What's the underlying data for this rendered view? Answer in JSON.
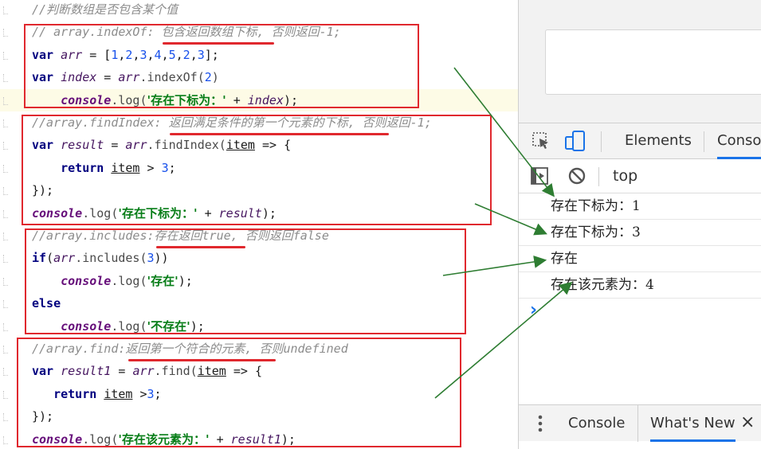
{
  "code_lines": [
    {
      "segments": [
        {
          "c": "cm",
          "t": "//判断数组是否包含某个值"
        }
      ]
    },
    {
      "segments": [
        {
          "c": "cm",
          "t": "// array.indexOf: 包含返回数组下标, 否则返回-1;"
        }
      ]
    },
    {
      "segments": [
        {
          "c": "kw",
          "t": "var "
        },
        {
          "c": "var",
          "t": "arr"
        },
        {
          "c": "",
          "t": " = ["
        },
        {
          "c": "num",
          "t": "1"
        },
        {
          "c": "",
          "t": ","
        },
        {
          "c": "num",
          "t": "2"
        },
        {
          "c": "",
          "t": ","
        },
        {
          "c": "num",
          "t": "3"
        },
        {
          "c": "",
          "t": ","
        },
        {
          "c": "num",
          "t": "4"
        },
        {
          "c": "",
          "t": ","
        },
        {
          "c": "num",
          "t": "5"
        },
        {
          "c": "",
          "t": ","
        },
        {
          "c": "num",
          "t": "2"
        },
        {
          "c": "",
          "t": ","
        },
        {
          "c": "num",
          "t": "3"
        },
        {
          "c": "",
          "t": "];"
        }
      ]
    },
    {
      "segments": [
        {
          "c": "kw",
          "t": "var "
        },
        {
          "c": "var",
          "t": "index"
        },
        {
          "c": "",
          "t": " = "
        },
        {
          "c": "var",
          "t": "arr"
        },
        {
          "c": "fn",
          "t": ".indexOf("
        },
        {
          "c": "num",
          "t": "2"
        },
        {
          "c": "fn",
          "t": ")"
        }
      ]
    },
    {
      "segments": [
        {
          "c": "",
          "t": "    "
        },
        {
          "c": "con",
          "t": "console"
        },
        {
          "c": "fn",
          "t": ".log("
        },
        {
          "c": "str",
          "t": "'存在下标为：'"
        },
        {
          "c": "",
          "t": " + "
        },
        {
          "c": "var",
          "t": "index"
        },
        {
          "c": "",
          "t": ");"
        }
      ]
    },
    {
      "segments": [
        {
          "c": "cm",
          "t": "//array.findIndex: 返回满足条件的第一个元素的下标, 否则返回-1;"
        }
      ]
    },
    {
      "segments": [
        {
          "c": "kw",
          "t": "var "
        },
        {
          "c": "var",
          "t": "result"
        },
        {
          "c": "",
          "t": " = "
        },
        {
          "c": "var",
          "t": "arr"
        },
        {
          "c": "fn",
          "t": ".findIndex("
        },
        {
          "c": "ul",
          "t": "item"
        },
        {
          "c": "",
          "t": " => {"
        }
      ]
    },
    {
      "segments": [
        {
          "c": "",
          "t": "    "
        },
        {
          "c": "kw",
          "t": "return "
        },
        {
          "c": "ul",
          "t": "item"
        },
        {
          "c": "",
          "t": " > "
        },
        {
          "c": "num",
          "t": "3"
        },
        {
          "c": "",
          "t": ";"
        }
      ]
    },
    {
      "segments": [
        {
          "c": "",
          "t": "});"
        }
      ]
    },
    {
      "segments": [
        {
          "c": "con",
          "t": "console"
        },
        {
          "c": "fn",
          "t": ".log("
        },
        {
          "c": "str",
          "t": "'存在下标为：'"
        },
        {
          "c": "",
          "t": " + "
        },
        {
          "c": "var",
          "t": "result"
        },
        {
          "c": "",
          "t": ");"
        }
      ]
    },
    {
      "segments": [
        {
          "c": "cm",
          "t": "//array.includes:存在返回true, 否则返回false"
        }
      ]
    },
    {
      "segments": [
        {
          "c": "kw",
          "t": "if"
        },
        {
          "c": "",
          "t": "("
        },
        {
          "c": "var",
          "t": "arr"
        },
        {
          "c": "fn",
          "t": ".includes("
        },
        {
          "c": "num",
          "t": "3"
        },
        {
          "c": "",
          "t": "))"
        }
      ]
    },
    {
      "segments": [
        {
          "c": "",
          "t": "    "
        },
        {
          "c": "con",
          "t": "console"
        },
        {
          "c": "fn",
          "t": ".log("
        },
        {
          "c": "str",
          "t": "'存在'"
        },
        {
          "c": "",
          "t": ");"
        }
      ]
    },
    {
      "segments": [
        {
          "c": "kw",
          "t": "else"
        }
      ]
    },
    {
      "segments": [
        {
          "c": "",
          "t": "    "
        },
        {
          "c": "con",
          "t": "console"
        },
        {
          "c": "fn",
          "t": ".log("
        },
        {
          "c": "str",
          "t": "'不存在'"
        },
        {
          "c": "",
          "t": ");"
        }
      ]
    },
    {
      "segments": [
        {
          "c": "cm",
          "t": "//array.find:返回第一个符合的元素, 否则undefined"
        }
      ]
    },
    {
      "segments": [
        {
          "c": "kw",
          "t": "var "
        },
        {
          "c": "var",
          "t": "result1"
        },
        {
          "c": "",
          "t": " = "
        },
        {
          "c": "var",
          "t": "arr"
        },
        {
          "c": "fn",
          "t": ".find("
        },
        {
          "c": "ul",
          "t": "item"
        },
        {
          "c": "",
          "t": " => {"
        }
      ]
    },
    {
      "segments": [
        {
          "c": "",
          "t": "   "
        },
        {
          "c": "kw",
          "t": "return "
        },
        {
          "c": "ul",
          "t": "item"
        },
        {
          "c": "",
          "t": " >"
        },
        {
          "c": "num",
          "t": "3"
        },
        {
          "c": "",
          "t": ";"
        }
      ]
    },
    {
      "segments": [
        {
          "c": "",
          "t": "});"
        }
      ]
    },
    {
      "segments": [
        {
          "c": "con",
          "t": "console"
        },
        {
          "c": "fn",
          "t": ".log("
        },
        {
          "c": "str",
          "t": "'存在该元素为：'"
        },
        {
          "c": "",
          "t": " + "
        },
        {
          "c": "var",
          "t": "result1"
        },
        {
          "c": "",
          "t": ");"
        }
      ]
    }
  ],
  "devtools": {
    "tabs": {
      "elements": "Elements",
      "console": "Conso"
    },
    "toolbar": {
      "context": "top"
    },
    "console_output": [
      "存在下标为：1",
      "存在下标为：3",
      "存在",
      "存在该元素为：4"
    ],
    "prompt": "›",
    "drawer": {
      "console": "Console",
      "whats_new": "What's New",
      "close": "×"
    }
  },
  "colors": {
    "annotation": "#e0282e",
    "arrow": "#2e7d32",
    "accent": "#1a73e8"
  }
}
